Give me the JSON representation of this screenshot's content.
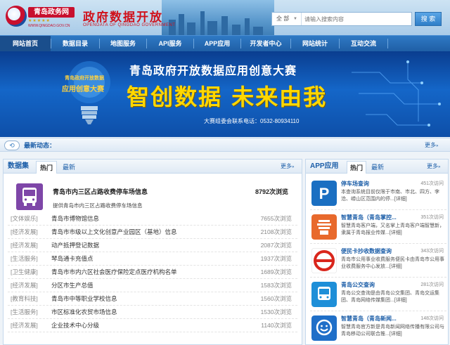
{
  "header": {
    "logo_text": "青岛政务网",
    "logo_url": "WWW.QINGDAO.GOV.CN",
    "site_title": "政府数据开放",
    "site_subtitle": "OPENDATA OF QINGDAO GOVERNMENT",
    "search": {
      "scope": "全 部",
      "placeholder": "请输入搜索内容",
      "button": "搜 索"
    }
  },
  "nav": {
    "items": [
      {
        "label": "网站首页"
      },
      {
        "label": "数据目录"
      },
      {
        "label": "地图服务"
      },
      {
        "label": "API服务"
      },
      {
        "label": "APP应用"
      },
      {
        "label": "开发者中心"
      },
      {
        "label": "网站统计"
      },
      {
        "label": "互动交流"
      }
    ]
  },
  "banner": {
    "badge_line1": "青岛政府开放数据",
    "badge_line2": "应用创意大赛",
    "title": "青岛政府开放数据应用创意大赛",
    "slogan": "智创数据  未来由我",
    "contact": "大赛组委会联系电话：0532-80934110"
  },
  "news": {
    "label": "最新动态：",
    "more": "更多"
  },
  "datasets": {
    "title": "数据集",
    "tabs": [
      "热门",
      "最新"
    ],
    "more": "更多",
    "featured": {
      "name": "青岛市内三区占路收费停车场信息",
      "views": "8792次浏览",
      "desc": "提供青岛市内三区占路收费停车场信息"
    },
    "rows": [
      {
        "category": "[文体娱乐]",
        "name": "青岛市博物馆信息",
        "views": "7655次浏览"
      },
      {
        "category": "[经济发展]",
        "name": "青岛市市级以上文化创意产业园区（基地）信息",
        "views": "2108次浏览"
      },
      {
        "category": "[经济发展]",
        "name": "动产抵押登记数据",
        "views": "2087次浏览"
      },
      {
        "category": "[生活服务]",
        "name": "琴岛通卡充值点",
        "views": "1937次浏览"
      },
      {
        "category": "[卫生健康]",
        "name": "青岛市市内六区社会医疗保险定点医疗机构名单",
        "views": "1689次浏览"
      },
      {
        "category": "[经济发展]",
        "name": "分区市生产总值",
        "views": "1583次浏览"
      },
      {
        "category": "[教育科技]",
        "name": "青岛市中等职业学校信息",
        "views": "1560次浏览"
      },
      {
        "category": "[生活服务]",
        "name": "市区标准化农贸市场信息",
        "views": "1530次浏览"
      },
      {
        "category": "[经济发展]",
        "name": "企业技术中心分级",
        "views": "1140次浏览"
      }
    ]
  },
  "apps": {
    "title": "APP应用",
    "tabs": [
      "热门",
      "最新"
    ],
    "more": "更多",
    "items": [
      {
        "name": "停车场查询",
        "views": "451次访问",
        "desc": "本查询系统目前仅限于市南、市北、四方、李沧、崂山区范围内的停...",
        "link": "[详细]",
        "icon_color": "#1a6fc2",
        "icon": "P"
      },
      {
        "name": "智慧青岛（青岛掌控...",
        "views": "351次访问",
        "desc": "智慧青岛客户端，又名掌上青岛客户端智慧新，隶属于青岛报业传媒...",
        "link": "[详细]",
        "icon_color": "#e8692c",
        "icon": "城"
      },
      {
        "name": "便民卡抄收数据查询",
        "views": "343次访问",
        "desc": "青岛市公用事业收费服务便民卡由青岛市公用事业收费服务中心发放...",
        "link": "[详细]",
        "icon_color": "#ffffff",
        "icon": "◎"
      },
      {
        "name": "青岛公交查询",
        "views": "281次访问",
        "desc": "青岛公交查询是由青岛公交集团、青岛交运集团、青岛网络传媒集团...",
        "link": "[详细]",
        "icon_color": "#1e8fd8",
        "icon": "▣"
      },
      {
        "name": "智慧青岛（青岛新闻...",
        "views": "148次访问",
        "desc": "智慧青岛官方新是青岛新闻网络传播有限公司与青岛移动公司联合推...",
        "link": "[详细]",
        "icon_color": "#1f6fc8",
        "icon": "☺"
      }
    ]
  }
}
